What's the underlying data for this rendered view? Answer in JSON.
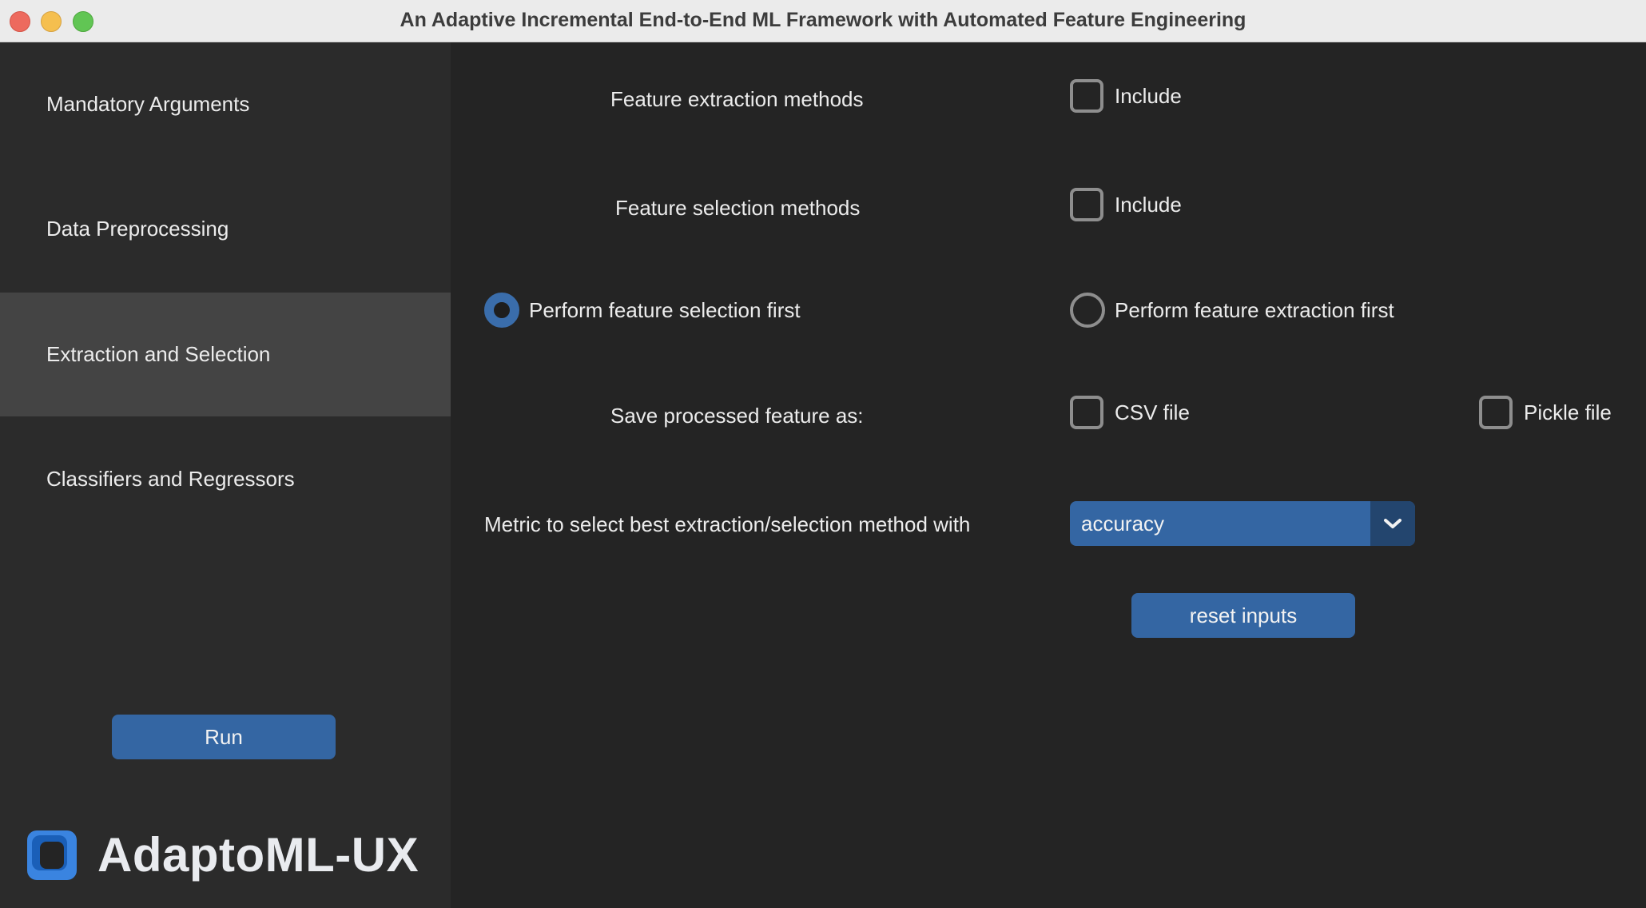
{
  "window": {
    "title": "An Adaptive Incremental End-to-End ML Framework with Automated Feature Engineering"
  },
  "sidebar": {
    "items": [
      {
        "label": "Mandatory Arguments",
        "active": false
      },
      {
        "label": "Data Preprocessing",
        "active": false
      },
      {
        "label": "Extraction and Selection",
        "active": true
      },
      {
        "label": "Classifiers and Regressors",
        "active": false
      }
    ],
    "run_label": "Run",
    "logo_text": "AdaptoML-UX"
  },
  "main": {
    "feature_extraction": {
      "label": "Feature extraction methods",
      "checkbox_label": "Include",
      "checked": false
    },
    "feature_selection": {
      "label": "Feature selection methods",
      "checkbox_label": "Include",
      "checked": false
    },
    "order": {
      "option_selection_first": "Perform feature selection first",
      "option_extraction_first": "Perform feature extraction first",
      "selected": "selection_first"
    },
    "save": {
      "label": "Save processed feature as:",
      "csv_label": "CSV file",
      "pickle_label": "Pickle file",
      "csv_checked": false,
      "pickle_checked": false
    },
    "metric": {
      "label": "Metric to select best extraction/selection method with",
      "selected": "accuracy"
    },
    "reset_label": "reset inputs"
  },
  "colors": {
    "accent": "#3466a3",
    "accent_dark": "#23456e",
    "sidebar_bg": "#2b2b2b",
    "sidebar_active_bg": "#444444",
    "main_bg": "#242424"
  },
  "icons": {
    "dropdown": "chevron-down-icon",
    "logo": "app-logo-icon"
  }
}
